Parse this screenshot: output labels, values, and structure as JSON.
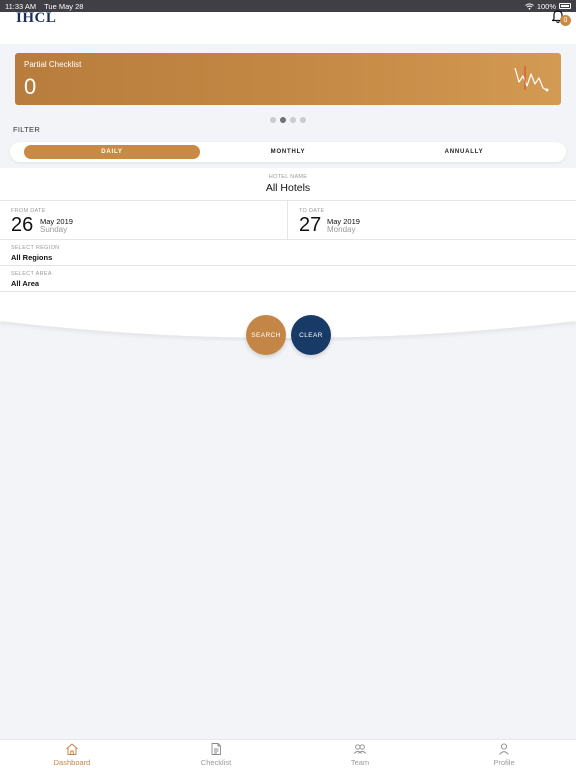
{
  "status_bar": {
    "time": "11:33 AM",
    "date": "Tue May 28",
    "battery": "100%"
  },
  "header": {
    "logo": "IHCL",
    "notification_count": "0"
  },
  "summary_card": {
    "label": "Partial Checklist",
    "value": "0"
  },
  "pager": {
    "count": 4,
    "active_index": 1
  },
  "filter": {
    "title": "FILTER",
    "tabs": [
      "DAILY",
      "MONTHLY",
      "ANNUALLY"
    ],
    "active_tab": "DAILY"
  },
  "form": {
    "hotel": {
      "caption": "HOTEL NAME",
      "value": "All Hotels"
    },
    "from_date": {
      "caption": "FROM DATE",
      "day": "26",
      "month_year": "May 2019",
      "weekday": "Sunday"
    },
    "to_date": {
      "caption": "TO DATE",
      "day": "27",
      "month_year": "May 2019",
      "weekday": "Monday"
    },
    "region": {
      "caption": "SELECT REGION",
      "value": "All Regions"
    },
    "area": {
      "caption": "SELECT AREA",
      "value": "All Area"
    }
  },
  "actions": {
    "search_label": "SEARCH",
    "clear_label": "CLEAR"
  },
  "tab_bar": {
    "items": [
      {
        "label": "Dashboard",
        "icon": "home-icon"
      },
      {
        "label": "Checklist",
        "icon": "document-icon"
      },
      {
        "label": "Team",
        "icon": "team-icon"
      },
      {
        "label": "Profile",
        "icon": "person-icon"
      }
    ],
    "active": "Dashboard"
  },
  "colors": {
    "accent": "#c48646",
    "navy": "#173a66",
    "background": "#f3f4f8"
  }
}
